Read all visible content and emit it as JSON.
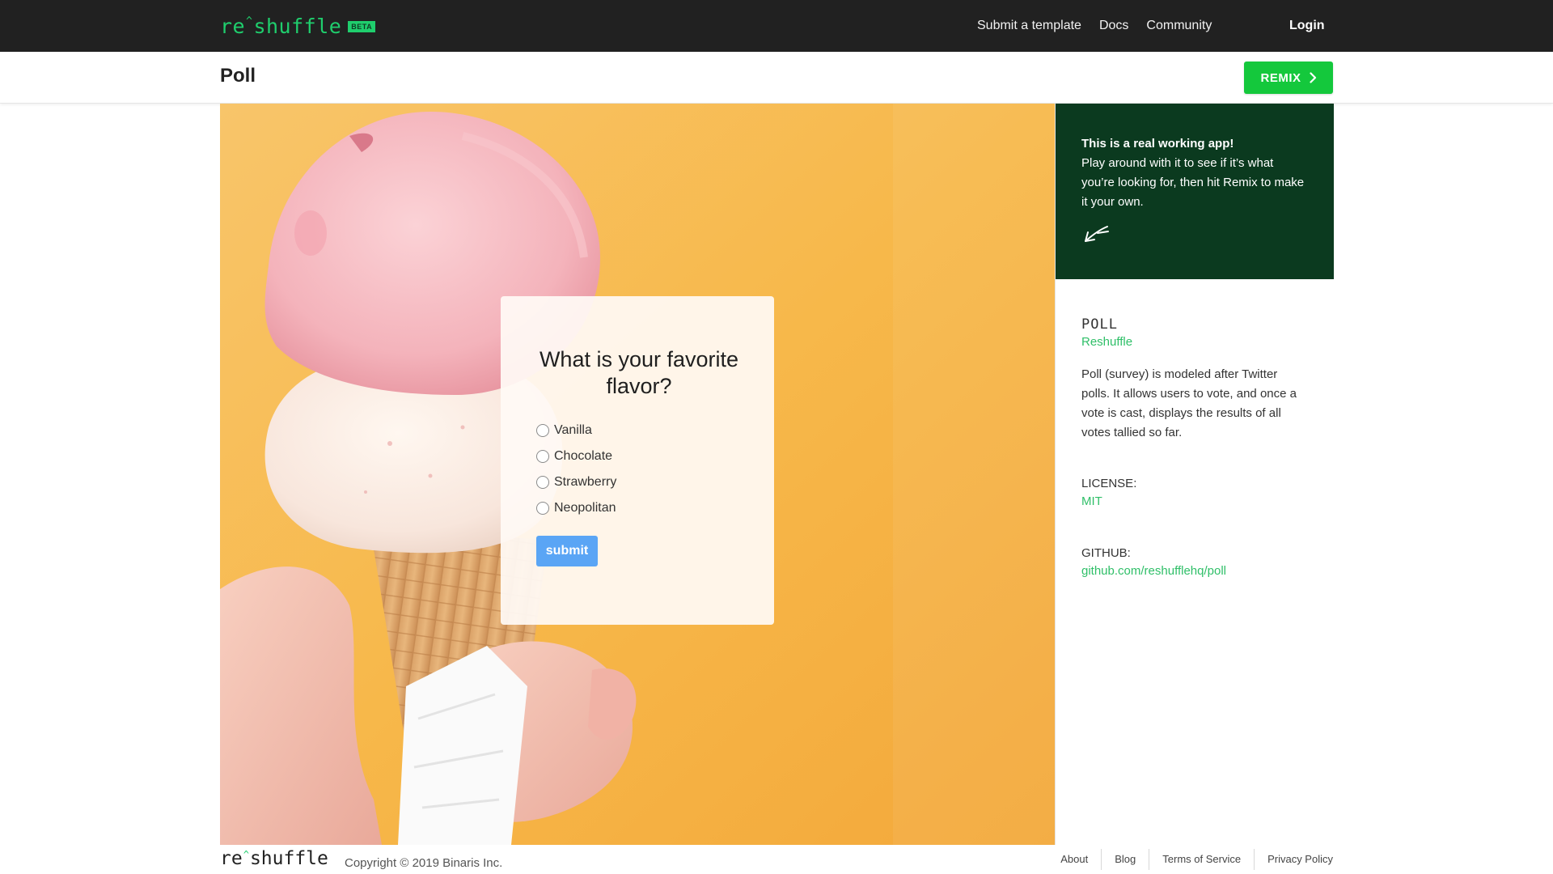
{
  "nav": {
    "logo_left": "re",
    "logo_caret": "^",
    "logo_right": "shuffle",
    "beta_badge": "BETA",
    "links": [
      "Submit a template",
      "Docs",
      "Community"
    ],
    "login": "Login"
  },
  "subheader": {
    "title": "Poll",
    "remix_label": "REMIX",
    "remix_icon": "chevron-right-icon"
  },
  "poll": {
    "question": "What is your favorite flavor?",
    "options": [
      "Vanilla",
      "Chocolate",
      "Strawberry",
      "Neopolitan"
    ],
    "submit_label": "submit"
  },
  "sidebar": {
    "callout_title": "This is a real working app!",
    "callout_body": "Play around with it to see if it’s what you’re looking for, then hit Remix to make it your own.",
    "callout_icon": "arrow-down-left-icon",
    "template_name": "POLL",
    "author": "Reshuffle",
    "description": "Poll (survey) is modeled after Twitter polls. It allows users to vote, and once a vote is cast, displays the results of all votes tallied so far.",
    "license_label": "LICENSE:",
    "license_value": "MIT",
    "github_label": "GITHUB:",
    "github_value": "github.com/reshufflehq/poll"
  },
  "footer": {
    "logo_left": "re",
    "logo_caret": "^",
    "logo_right": "shuffle",
    "copyright": "Copyright © 2019 Binaris Inc.",
    "links": [
      "About",
      "Blog",
      "Terms of Service",
      "Privacy Policy"
    ]
  },
  "colors": {
    "brand_green": "#1fce6d",
    "remix_green": "#14c83c",
    "callout_bg": "#0b3a1f",
    "link_green": "#2fbf68",
    "submit_blue": "#5aa5f5",
    "hero_bg": "#f6b53c"
  }
}
